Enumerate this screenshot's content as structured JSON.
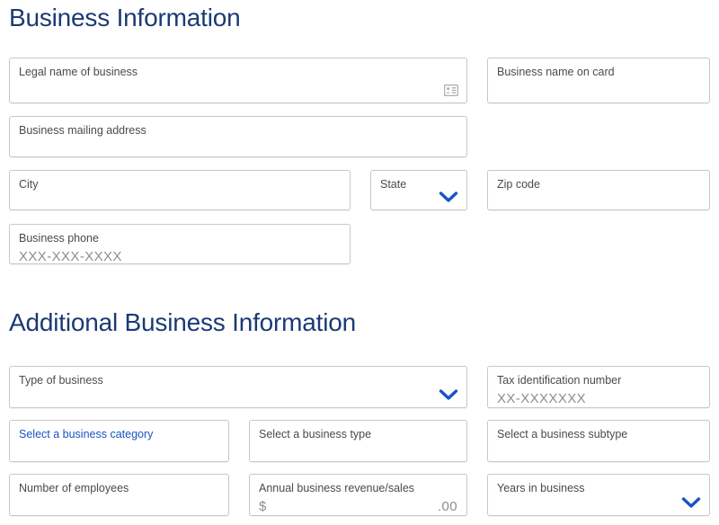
{
  "sections": [
    {
      "id": "business_information",
      "heading": "Business Information"
    },
    {
      "id": "additional_business_information",
      "heading": "Additional Business Information"
    }
  ],
  "colors": {
    "heading_navy": "#1b3a75",
    "link_blue": "#1a53c4",
    "chevron_blue": "#1a53c4",
    "field_border": "#c8c8c8",
    "label_gray": "#4a4a4a",
    "placeholder_gray": "#8d8d8d"
  },
  "fields": {
    "legal_name": {
      "label": "Legal name of business",
      "value": "",
      "icon": "contact-card-icon"
    },
    "business_name_on_card": {
      "label": "Business name on card",
      "value": ""
    },
    "mailing_address": {
      "label": "Business mailing address",
      "value": ""
    },
    "city": {
      "label": "City",
      "value": ""
    },
    "state": {
      "label": "State",
      "value": "",
      "icon": "chevron-down-icon"
    },
    "zip_code": {
      "label": "Zip code",
      "value": ""
    },
    "business_phone": {
      "label": "Business phone",
      "placeholder": "XXX-XXX-XXXX"
    },
    "type_of_business": {
      "label": "Type of business",
      "value": "",
      "icon": "chevron-down-icon"
    },
    "tax_id_number": {
      "label": "Tax identification number",
      "placeholder": "XX-XXXXXXX"
    },
    "business_category": {
      "label": "Select a business category",
      "value": ""
    },
    "business_type": {
      "label": "Select a business type",
      "value": ""
    },
    "business_subtype": {
      "label": "Select a business subtype",
      "value": ""
    },
    "number_of_employees": {
      "label": "Number of employees",
      "value": ""
    },
    "annual_revenue": {
      "label": "Annual business revenue/sales",
      "prefix": "$",
      "suffix": ".00"
    },
    "years_in_business": {
      "label": "Years in business",
      "value": "",
      "icon": "chevron-down-icon"
    }
  }
}
